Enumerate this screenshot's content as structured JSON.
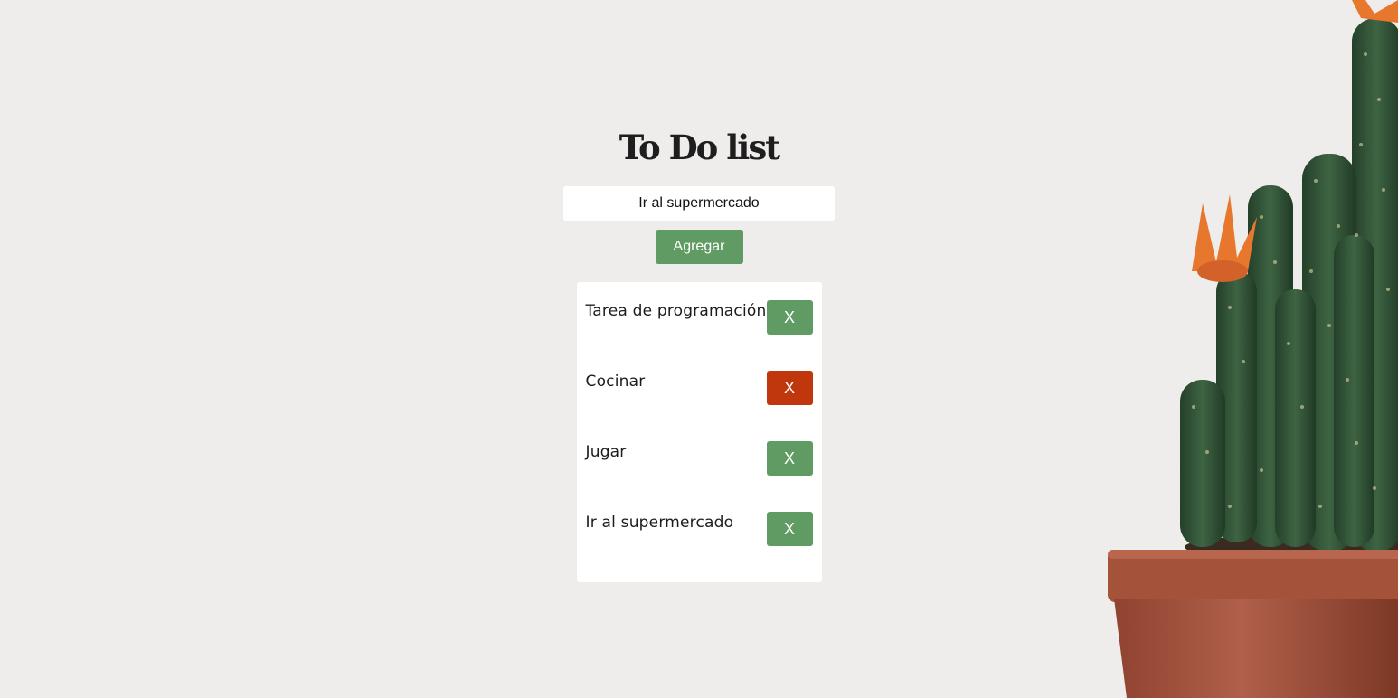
{
  "app": {
    "title": "To Do list",
    "input_value": "Ir al supermercado",
    "add_label": "Agregar"
  },
  "tasks": [
    {
      "text": "Tarea de programación",
      "delete_label": "X",
      "delete_color": "#5f9b62"
    },
    {
      "text": "Cocinar",
      "delete_label": "X",
      "delete_color": "#c1370d"
    },
    {
      "text": "Jugar",
      "delete_label": "X",
      "delete_color": "#5f9b62"
    },
    {
      "text": "Ir al supermercado",
      "delete_label": "X",
      "delete_color": "#5f9b62"
    }
  ],
  "colors": {
    "background": "#efedeb",
    "accent_green": "#5f9b62",
    "delete_hover_red": "#c1370d",
    "pot": "#a4533a",
    "cactus": "#2e4a30",
    "flower": "#e8772e"
  },
  "decor": {
    "background_image": "cactus-in-pot-icon"
  }
}
